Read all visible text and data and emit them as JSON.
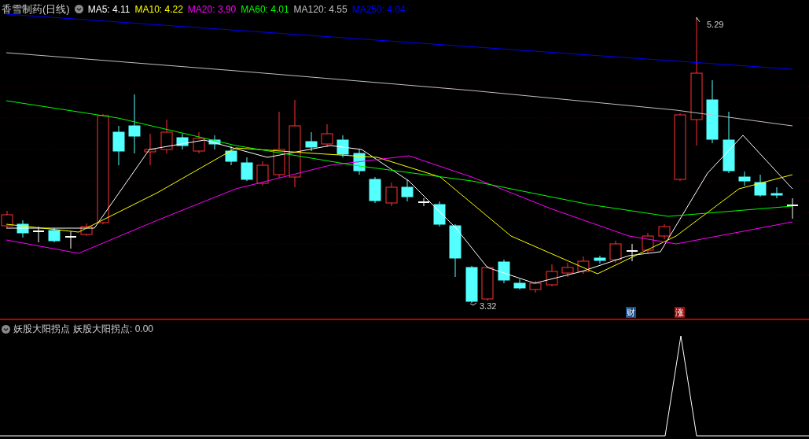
{
  "main_panel": {
    "title": "香雪制药(日线)",
    "legend": [
      {
        "label": "MA5: 4.11",
        "color": "#ffffff"
      },
      {
        "label": "MA10: 4.22",
        "color": "#ffff00"
      },
      {
        "label": "MA20: 3.90",
        "color": "#ff00ff"
      },
      {
        "label": "MA60: 4.01",
        "color": "#00ff00"
      },
      {
        "label": "MA120: 4.55",
        "color": "#c0c0c0"
      },
      {
        "label": "MA250: 4.04",
        "color": "#0000ff"
      }
    ],
    "high_label": "5.29",
    "low_label": "3.32",
    "badges": [
      {
        "label": "财",
        "color": "#1e4f8c"
      },
      {
        "label": "涨",
        "color": "#a01010"
      }
    ]
  },
  "indicator_panel": {
    "name": "妖股大阳拐点",
    "reading": "妖股大阳拐点: 0.00"
  }
}
